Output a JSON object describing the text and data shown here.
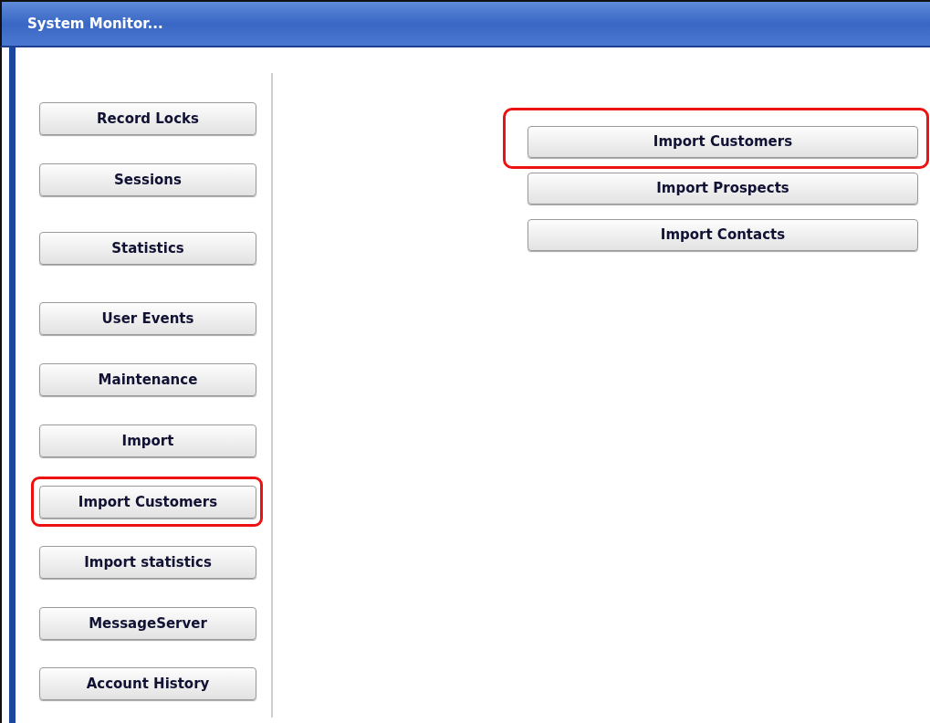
{
  "window": {
    "title": "System Monitor..."
  },
  "sidebar": {
    "buttons": [
      {
        "label": "Record Locks",
        "highlighted": false
      },
      {
        "label": "Sessions",
        "highlighted": false
      },
      {
        "label": "Statistics",
        "highlighted": false
      },
      {
        "label": "User Events",
        "highlighted": false
      },
      {
        "label": "Maintenance",
        "highlighted": false
      },
      {
        "label": "Import",
        "highlighted": false
      },
      {
        "label": "Import Customers",
        "highlighted": true
      },
      {
        "label": "Import statistics",
        "highlighted": false
      },
      {
        "label": "MessageServer",
        "highlighted": false
      },
      {
        "label": "Account History",
        "highlighted": false
      }
    ]
  },
  "import_panel": {
    "buttons": [
      {
        "label": "Import Customers",
        "highlighted": true
      },
      {
        "label": "Import Prospects",
        "highlighted": false
      },
      {
        "label": "Import Contacts",
        "highlighted": false
      }
    ]
  }
}
